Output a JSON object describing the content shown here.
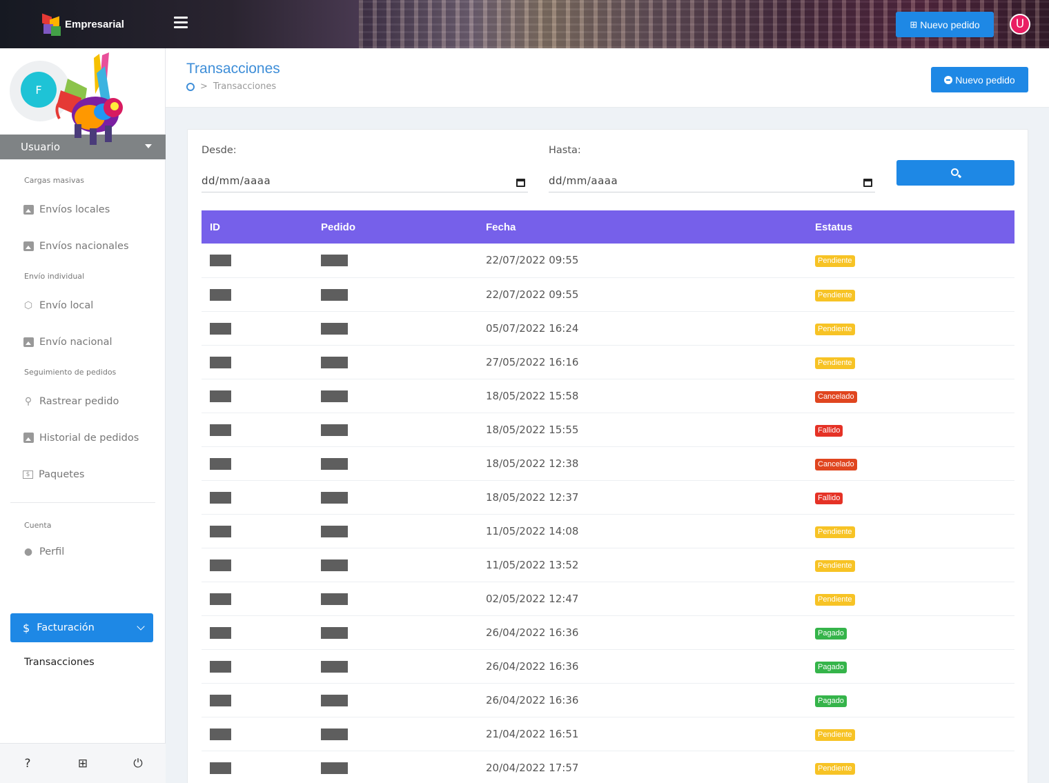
{
  "topbar": {
    "brand": "Empresarial",
    "new_order_label": "Nuevo pedido",
    "user_initial": "U"
  },
  "sidebar": {
    "avatar_initial": "F",
    "user_label": "Usuario",
    "sections": {
      "bulk": "Cargas masivas",
      "individual": "Envío individual",
      "tracking": "Seguimiento de pedidos",
      "account": "Cuenta"
    },
    "items": {
      "local_shipments": "Envíos locales",
      "national_shipments": "Envíos nacionales",
      "local_shipment": "Envío local",
      "national_shipment": "Envío nacional",
      "track_order": "Rastrear pedido",
      "order_history": "Historial de pedidos",
      "packages": "Paquetes",
      "profile": "Perfil",
      "billing": "Facturación",
      "transactions": "Transacciones"
    },
    "footer": {
      "help": "?"
    }
  },
  "page": {
    "title": "Transacciones",
    "breadcrumb_current": "Transacciones",
    "new_order_label": "Nuevo pedido"
  },
  "filters": {
    "from_label": "Desde:",
    "to_label": "Hasta:",
    "from_value": "dd/mm/aaaa",
    "to_value": "dd/mm/aaaa"
  },
  "table": {
    "headers": [
      "ID",
      "Pedido",
      "Fecha",
      "Estatus"
    ],
    "rows": [
      {
        "fecha": "22/07/2022 09:55",
        "estatus": "Pendiente"
      },
      {
        "fecha": "22/07/2022 09:55",
        "estatus": "Pendiente"
      },
      {
        "fecha": "05/07/2022 16:24",
        "estatus": "Pendiente"
      },
      {
        "fecha": "27/05/2022 16:16",
        "estatus": "Pendiente"
      },
      {
        "fecha": "18/05/2022 15:58",
        "estatus": "Cancelado"
      },
      {
        "fecha": "18/05/2022 15:55",
        "estatus": "Fallido"
      },
      {
        "fecha": "18/05/2022 12:38",
        "estatus": "Cancelado"
      },
      {
        "fecha": "18/05/2022 12:37",
        "estatus": "Fallido"
      },
      {
        "fecha": "11/05/2022 14:08",
        "estatus": "Pendiente"
      },
      {
        "fecha": "11/05/2022 13:52",
        "estatus": "Pendiente"
      },
      {
        "fecha": "02/05/2022 12:47",
        "estatus": "Pendiente"
      },
      {
        "fecha": "26/04/2022 16:36",
        "estatus": "Pagado"
      },
      {
        "fecha": "26/04/2022 16:36",
        "estatus": "Pagado"
      },
      {
        "fecha": "26/04/2022 16:36",
        "estatus": "Pagado"
      },
      {
        "fecha": "21/04/2022 16:51",
        "estatus": "Pendiente"
      },
      {
        "fecha": "20/04/2022 17:57",
        "estatus": "Pendiente"
      }
    ]
  },
  "colors": {
    "primary": "#1e88e5",
    "table_header": "#7660ea",
    "pendiente": "#f7c325",
    "cancelado": "#e0451f",
    "fallido": "#e53226",
    "pagado": "#35b44a"
  }
}
